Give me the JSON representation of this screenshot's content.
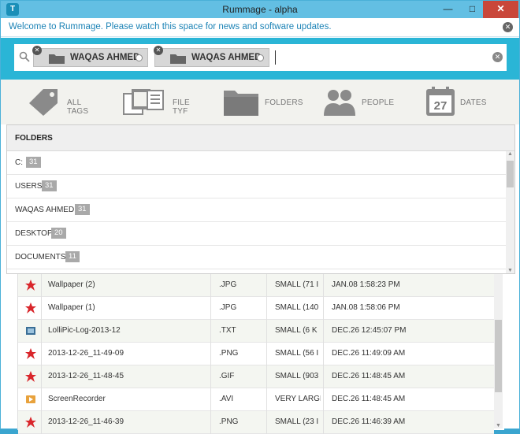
{
  "window": {
    "title": "Rummage - alpha",
    "app_icon": "T",
    "minimize": "—",
    "maximize": "□",
    "close": "✕"
  },
  "banner": {
    "text": "Welcome to Rummage. Please watch this space for news and software updates.",
    "close": "✕"
  },
  "search": {
    "chips": [
      {
        "label": "WAQAS AHMED",
        "remove": "✕"
      },
      {
        "label": "WAQAS AHMED",
        "remove": "✕"
      }
    ],
    "clear": "✕"
  },
  "tabs": [
    {
      "label": "ALL TAGS",
      "icon": "tag-icon"
    },
    {
      "label": "FILE TYF",
      "icon": "file-types-icon"
    },
    {
      "label": "FOLDERS",
      "icon": "folder-icon"
    },
    {
      "label": "PEOPLE",
      "icon": "people-icon"
    },
    {
      "label": "DATES",
      "icon": "calendar-icon",
      "calendar_day": "27"
    }
  ],
  "folders": {
    "header": "FOLDERS",
    "items": [
      {
        "name": "C:",
        "count": "31"
      },
      {
        "name": "USERS",
        "count": "31"
      },
      {
        "name": "WAQAS AHMED",
        "count": "31"
      },
      {
        "name": "DESKTOP",
        "count": "20"
      },
      {
        "name": "DOCUMENTS",
        "count": "11"
      }
    ]
  },
  "files": [
    {
      "name": "Wallpaper (2)",
      "ext": ".JPG",
      "size": "SMALL (71 I",
      "date": "JAN.08 1:58:23 PM",
      "icon": "image-icon"
    },
    {
      "name": "Wallpaper (1)",
      "ext": ".JPG",
      "size": "SMALL (140",
      "date": "JAN.08 1:58:06 PM",
      "icon": "image-icon"
    },
    {
      "name": "LolliPic-Log-2013-12",
      "ext": ".TXT",
      "size": "SMALL (6 K",
      "date": "DEC.26 12:45:07 PM",
      "icon": "text-file-icon"
    },
    {
      "name": "2013-12-26_11-49-09",
      "ext": ".PNG",
      "size": "SMALL (56 I",
      "date": "DEC.26 11:49:09 AM",
      "icon": "image-icon"
    },
    {
      "name": "2013-12-26_11-48-45",
      "ext": ".GIF",
      "size": "SMALL (903",
      "date": "DEC.26 11:48:45 AM",
      "icon": "image-icon"
    },
    {
      "name": "ScreenRecorder",
      "ext": ".AVI",
      "size": "VERY LARGI",
      "date": "DEC.26 11:48:45 AM",
      "icon": "video-file-icon"
    },
    {
      "name": "2013-12-26_11-46-39",
      "ext": ".PNG",
      "size": "SMALL (23 I",
      "date": "DEC.26 11:46:39 AM",
      "icon": "image-icon"
    }
  ],
  "colors": {
    "accent": "#2ab5d6",
    "titlebar": "#63bfe3",
    "close": "#c9473a",
    "file_icon_red": "#d9262b"
  }
}
